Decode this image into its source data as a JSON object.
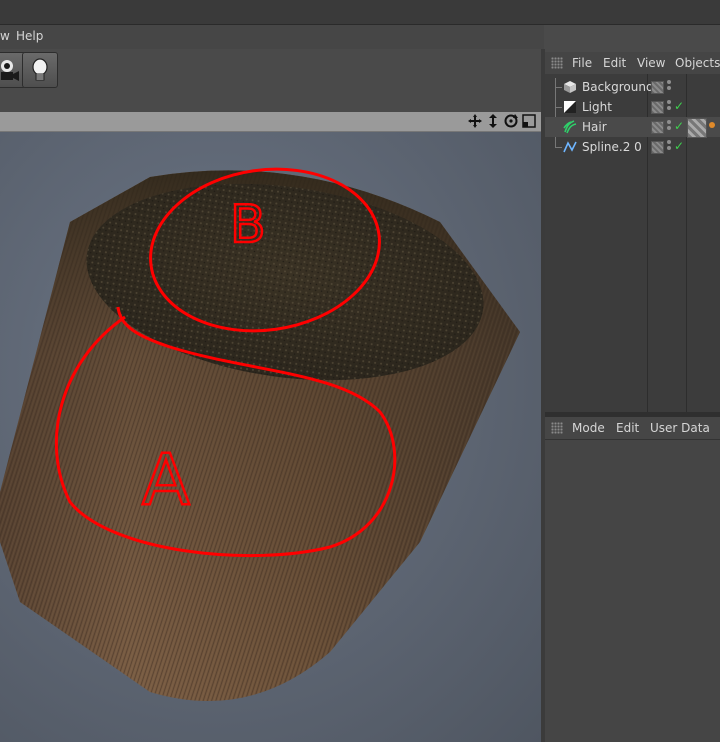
{
  "menubar": {
    "items": [
      "w",
      "Help"
    ]
  },
  "toolbar": {
    "buttons": [
      {
        "icon": "camera-icon"
      },
      {
        "icon": "light-bulb-icon"
      }
    ]
  },
  "viewport": {
    "nav_icons": [
      "move-icon",
      "zoom-icon",
      "rotate-icon",
      "maximize-icon"
    ],
    "annotations": {
      "top_label": "B",
      "side_label": "A",
      "annotation_color": "#ff0000"
    }
  },
  "object_manager": {
    "menu": [
      "File",
      "Edit",
      "View",
      "Objects"
    ],
    "objects": [
      {
        "name": "Background",
        "icon": "background-icon",
        "enabled_check": false
      },
      {
        "name": "Light",
        "icon": "light-icon",
        "enabled_check": true
      },
      {
        "name": "Hair",
        "icon": "hair-icon",
        "enabled_check": true,
        "selected": true,
        "has_tags": true
      },
      {
        "name": "Spline.2 0",
        "icon": "spline-icon",
        "enabled_check": true
      }
    ]
  },
  "attribute_manager": {
    "menu": [
      "Mode",
      "Edit",
      "User Data"
    ]
  },
  "colors": {
    "hair_dark": "#2e2a1f",
    "hair_light": "#8a6a4a",
    "check_green": "#3fd14f"
  }
}
